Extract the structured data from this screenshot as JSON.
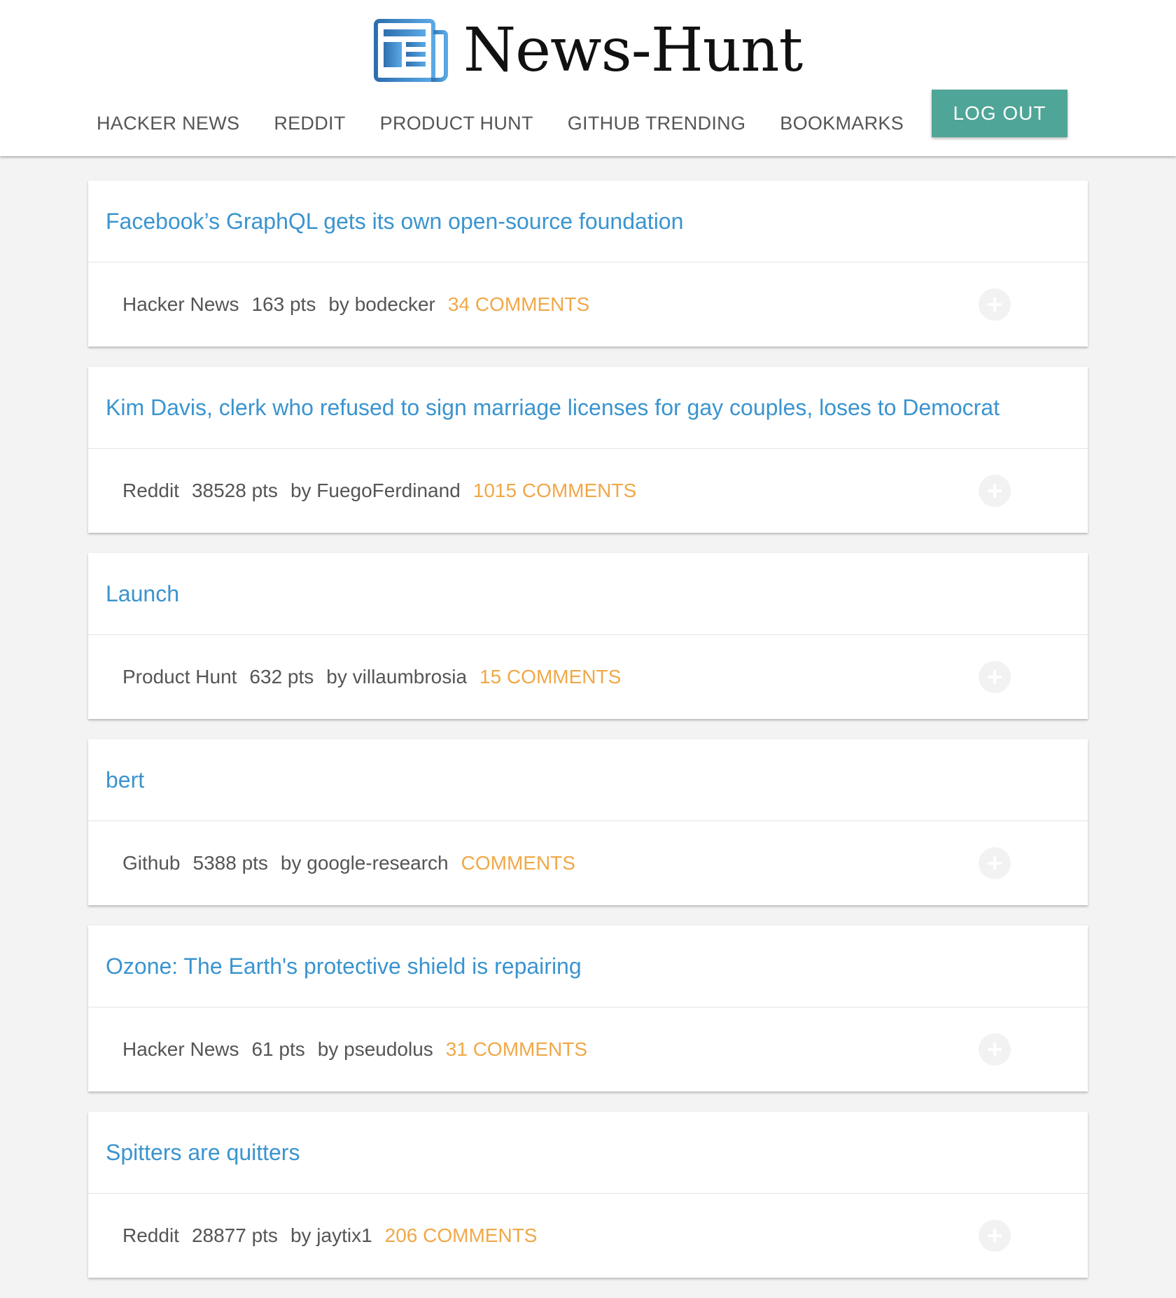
{
  "brand": {
    "title": "News-Hunt",
    "logo_icon": "newspaper-icon",
    "logo_color": "#3a8fd0"
  },
  "nav": {
    "items": [
      {
        "label": "HACKER NEWS"
      },
      {
        "label": "REDDIT"
      },
      {
        "label": "PRODUCT HUNT"
      },
      {
        "label": "GITHUB TRENDING"
      },
      {
        "label": "BOOKMARKS"
      }
    ],
    "logout_label": "LOG OUT"
  },
  "colors": {
    "accent": "#4fa597",
    "title_link": "#3a94cf",
    "comments": "#f0a848",
    "background": "#f3f3f3"
  },
  "stories": [
    {
      "title": "Facebook’s GraphQL gets its own open-source foundation",
      "source": "Hacker News",
      "points": "163 pts",
      "author": "by bodecker",
      "comments": "34 COMMENTS",
      "bookmark_icon": "plus-icon"
    },
    {
      "title": "Kim Davis, clerk who refused to sign marriage licenses for gay couples, loses to Democrat",
      "source": "Reddit",
      "points": "38528 pts",
      "author": "by FuegoFerdinand",
      "comments": "1015 COMMENTS",
      "bookmark_icon": "plus-icon"
    },
    {
      "title": "Launch",
      "source": "Product Hunt",
      "points": "632 pts",
      "author": "by villaumbrosia",
      "comments": "15 COMMENTS",
      "bookmark_icon": "plus-icon"
    },
    {
      "title": "bert",
      "source": "Github",
      "points": "5388 pts",
      "author": "by google-research",
      "comments": "COMMENTS",
      "bookmark_icon": "plus-icon"
    },
    {
      "title": "Ozone: The Earth's protective shield is repairing",
      "source": "Hacker News",
      "points": "61 pts",
      "author": "by pseudolus",
      "comments": "31 COMMENTS",
      "bookmark_icon": "plus-icon"
    },
    {
      "title": "Spitters are quitters",
      "source": "Reddit",
      "points": "28877 pts",
      "author": "by jaytix1",
      "comments": "206 COMMENTS",
      "bookmark_icon": "plus-icon"
    }
  ]
}
